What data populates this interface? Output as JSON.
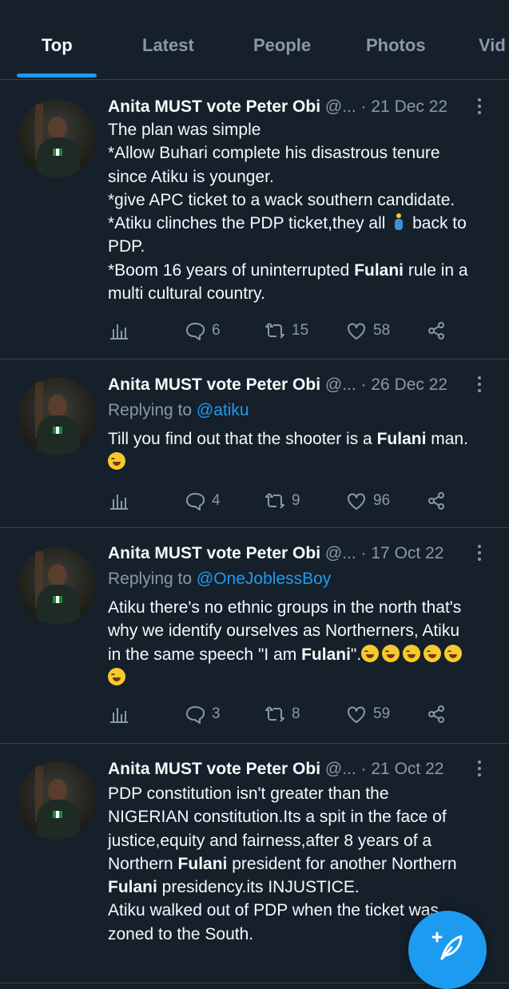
{
  "tabs": [
    {
      "label": "Top",
      "active": true
    },
    {
      "label": "Latest",
      "active": false
    },
    {
      "label": "People",
      "active": false
    },
    {
      "label": "Photos",
      "active": false
    },
    {
      "label": "Vid",
      "active": false
    }
  ],
  "tweets": [
    {
      "name": "Anita MUST vote Peter Obi",
      "handle": "@...",
      "date": "21 Dec 22",
      "lines": [
        [
          "The plan was simple"
        ],
        [
          "*Allow Buhari complete his disastrous tenure"
        ],
        [
          "since Atiku is younger."
        ],
        [
          "*give APC ticket to a wack southern candidate."
        ],
        [
          "*Atiku clinches the PDP ticket,they all ",
          "🏃",
          " back to"
        ],
        [
          "PDP."
        ],
        [
          "*Boom 16 years of uninterrupted ",
          "Fulani",
          " rule in a"
        ],
        [
          "multi cultural country."
        ]
      ],
      "replies": "6",
      "retweets": "15",
      "likes": "58"
    },
    {
      "name": "Anita MUST vote Peter Obi",
      "handle": "@...",
      "date": "26 Dec 22",
      "replying_to_label": "Replying to ",
      "replying_to": "@atiku",
      "lines": [
        [
          "Till you find out that the shooter is a ",
          "Fulani",
          " man."
        ],
        [
          "😂"
        ]
      ],
      "replies": "4",
      "retweets": "9",
      "likes": "96"
    },
    {
      "name": "Anita MUST vote Peter Obi",
      "handle": "@...",
      "date": "17 Oct 22",
      "replying_to_label": "Replying to ",
      "replying_to": "@OneJoblessBoy",
      "lines": [
        [
          "Atiku there's no ethnic groups in the north that's"
        ],
        [
          "why we identify ourselves as Northerners, Atiku"
        ],
        [
          "in the same speech \"I am ",
          "Fulani",
          "\".😂😂😂😂😂"
        ],
        [
          "😂"
        ]
      ],
      "replies": "3",
      "retweets": "8",
      "likes": "59"
    },
    {
      "name": "Anita MUST vote Peter Obi",
      "handle": "@...",
      "date": "21 Oct 22",
      "lines": [
        [
          "PDP constitution isn't greater than the"
        ],
        [
          "NIGERIAN constitution.Its a spit in the face of"
        ],
        [
          "justice,equity and fairness,after 8 years of a"
        ],
        [
          "Northern ",
          "Fulani",
          " president for another Northern"
        ],
        [
          "Fulani",
          " presidency.its INJUSTICE."
        ],
        [
          "Atiku walked out of PDP when the ticket was"
        ],
        [
          "zoned to the South."
        ]
      ]
    }
  ],
  "colors": {
    "background": "#15202b",
    "accent": "#1d9bf0",
    "muted": "#8b98a5",
    "text": "#f7f9f9",
    "divider": "#38444d"
  },
  "icons": {
    "views": "bar-chart-icon",
    "reply": "speech-bubble-icon",
    "retweet": "retweet-icon",
    "like": "heart-icon",
    "share": "share-icon",
    "more": "more-dots-icon",
    "compose": "compose-feather-icon"
  }
}
